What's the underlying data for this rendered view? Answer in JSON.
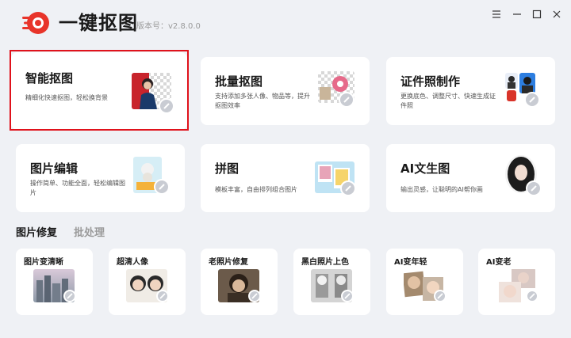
{
  "app": {
    "title": "一键抠图",
    "version": "版本号：v2.8.0.0",
    "brand_color": "#e8342a"
  },
  "window_controls": {
    "icons": [
      "menu-icon",
      "minimize-icon",
      "maximize-icon",
      "close-icon"
    ]
  },
  "features": [
    {
      "title": "智能抠图",
      "desc": "精细化快速抠图，轻松换背景",
      "selected": true
    },
    {
      "title": "批量抠图",
      "desc": "支持添加多张人像、物品等，提升抠图效率"
    },
    {
      "title": "证件照制作",
      "desc": "更换底色、调整尺寸、快速生成证件照"
    },
    {
      "title": "图片编辑",
      "desc": "操作简单、功能全面，轻松编辑图片"
    },
    {
      "title": "拼图",
      "desc": "模板丰富，自由排列组合图片"
    },
    {
      "title": "AI文生图",
      "desc": "输出灵感，让聪明的AI帮你画"
    }
  ],
  "tabs": [
    {
      "label": "图片修复",
      "active": true
    },
    {
      "label": "批处理",
      "active": false
    }
  ],
  "repair_tools": [
    {
      "title": "图片变清晰"
    },
    {
      "title": "超清人像"
    },
    {
      "title": "老照片修复"
    },
    {
      "title": "黑白照片上色"
    },
    {
      "title": "AI变年轻"
    },
    {
      "title": "AI变老"
    }
  ]
}
